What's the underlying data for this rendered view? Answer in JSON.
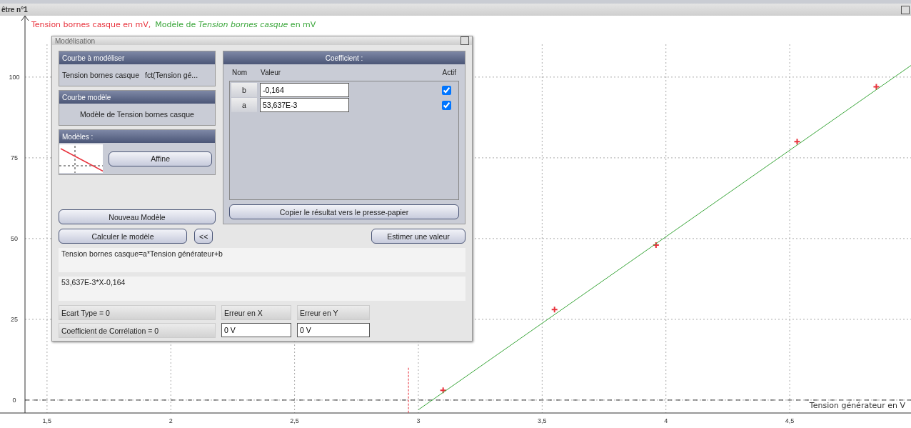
{
  "window": {
    "title": "être n°1"
  },
  "legend_separator": ",",
  "chart_data": {
    "type": "scatter",
    "xlabel": "Tension générateur en V",
    "xlim": [
      1.31,
      4.99
    ],
    "ylim": [
      -4,
      119
    ],
    "xticks": [
      {
        "value": 1.5,
        "label": "1,5"
      },
      {
        "value": 2,
        "label": "2"
      },
      {
        "value": 2.5,
        "label": "2,5"
      },
      {
        "value": 3,
        "label": "3"
      },
      {
        "value": 3.5,
        "label": "3,5"
      },
      {
        "value": 4,
        "label": "4"
      },
      {
        "value": 4.5,
        "label": "4,5"
      }
    ],
    "yticks": [
      0,
      25,
      50,
      75,
      100
    ],
    "grid": true,
    "ref_lines": [
      {
        "axis": "y",
        "value": 0,
        "color": "#333333"
      },
      {
        "axis": "x",
        "value": 2.96,
        "color": "#e8323c"
      }
    ],
    "series": [
      {
        "name": "Tension bornes casque en mV",
        "color": "#e8323c",
        "x": [
          3.1,
          3.55,
          3.96,
          4.53,
          4.85
        ],
        "values": [
          3,
          28,
          48,
          80,
          97
        ]
      },
      {
        "name": "Modèle de *Tension bornes casque* en mV",
        "color": "#3aa63a",
        "type": "line",
        "x": [
          3.0,
          4.99
        ],
        "values": [
          -3,
          103.6
        ]
      }
    ]
  },
  "dialog": {
    "title": "Modélisation",
    "curve_to_model": {
      "header": "Courbe à modéliser",
      "name": "Tension bornes casque",
      "function": "fct(Tension gé..."
    },
    "model_curve": {
      "header": "Courbe modèle",
      "value": "Modèle de Tension bornes casque"
    },
    "models": {
      "header": "Modèles :",
      "button": "Affine"
    },
    "coefficient": {
      "header": "Coefficient :",
      "columns": [
        "Nom",
        "Valeur",
        "Actif"
      ],
      "rows": [
        {
          "name": "b",
          "value": "-0,164",
          "active": true
        },
        {
          "name": "a",
          "value": "53,637E-3",
          "active": true
        }
      ]
    },
    "copy_button": "Copier le résultat vers le presse-papier",
    "new_model_button": "Nouveau Modèle",
    "compute_button": "Calculer le modèle",
    "collapse_button": "<<",
    "estimate_button": "Estimer une valeur",
    "equation": "Tension bornes casque=a*Tension générateur+b",
    "expression": "53,637E-3*X-0,164",
    "std_dev": "Ecart Type = 0",
    "correlation": "Coefficient de Corrélation = 0",
    "error_x_label": "Erreur en X",
    "error_y_label": "Erreur en Y",
    "error_x_value": "0 V",
    "error_y_value": "0 V"
  }
}
